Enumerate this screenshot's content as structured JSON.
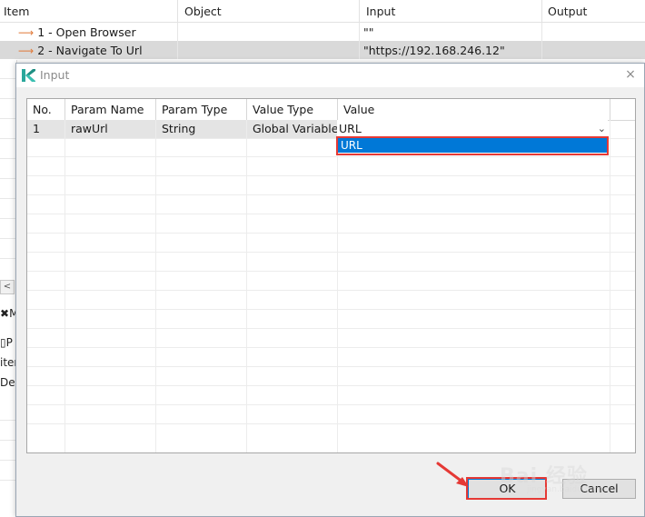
{
  "background": {
    "columns": [
      "Item",
      "Object",
      "Input",
      "Output"
    ],
    "rows": [
      {
        "item": "1 - Open Browser",
        "object": "",
        "input": "\"\"",
        "output": ""
      },
      {
        "item": "2 - Navigate To Url",
        "object": "",
        "input": "\"https://192.168.246.12\"",
        "output": ""
      }
    ],
    "left_fragments": [
      "M",
      "P",
      "iter",
      "Des"
    ],
    "scroll_left_glyph": "<"
  },
  "dialog": {
    "title": "Input",
    "close_glyph": "×",
    "grid": {
      "columns": [
        "No.",
        "Param Name",
        "Param Type",
        "Value Type",
        "Value"
      ],
      "rows": [
        {
          "no": "1",
          "param_name": "rawUrl",
          "param_type": "String",
          "value_type": "Global Variable",
          "value": "URL"
        }
      ]
    },
    "dropdown": {
      "options": [
        "URL"
      ],
      "chevron": "⌄"
    },
    "buttons": {
      "ok": "OK",
      "cancel": "Cancel"
    }
  },
  "watermark": {
    "text": "Bai 经验",
    "sub": "jingyan.baidu.com"
  },
  "colors": {
    "highlight": "#e53935",
    "selection": "#0078d7",
    "x_icon": "#e07a3a"
  }
}
